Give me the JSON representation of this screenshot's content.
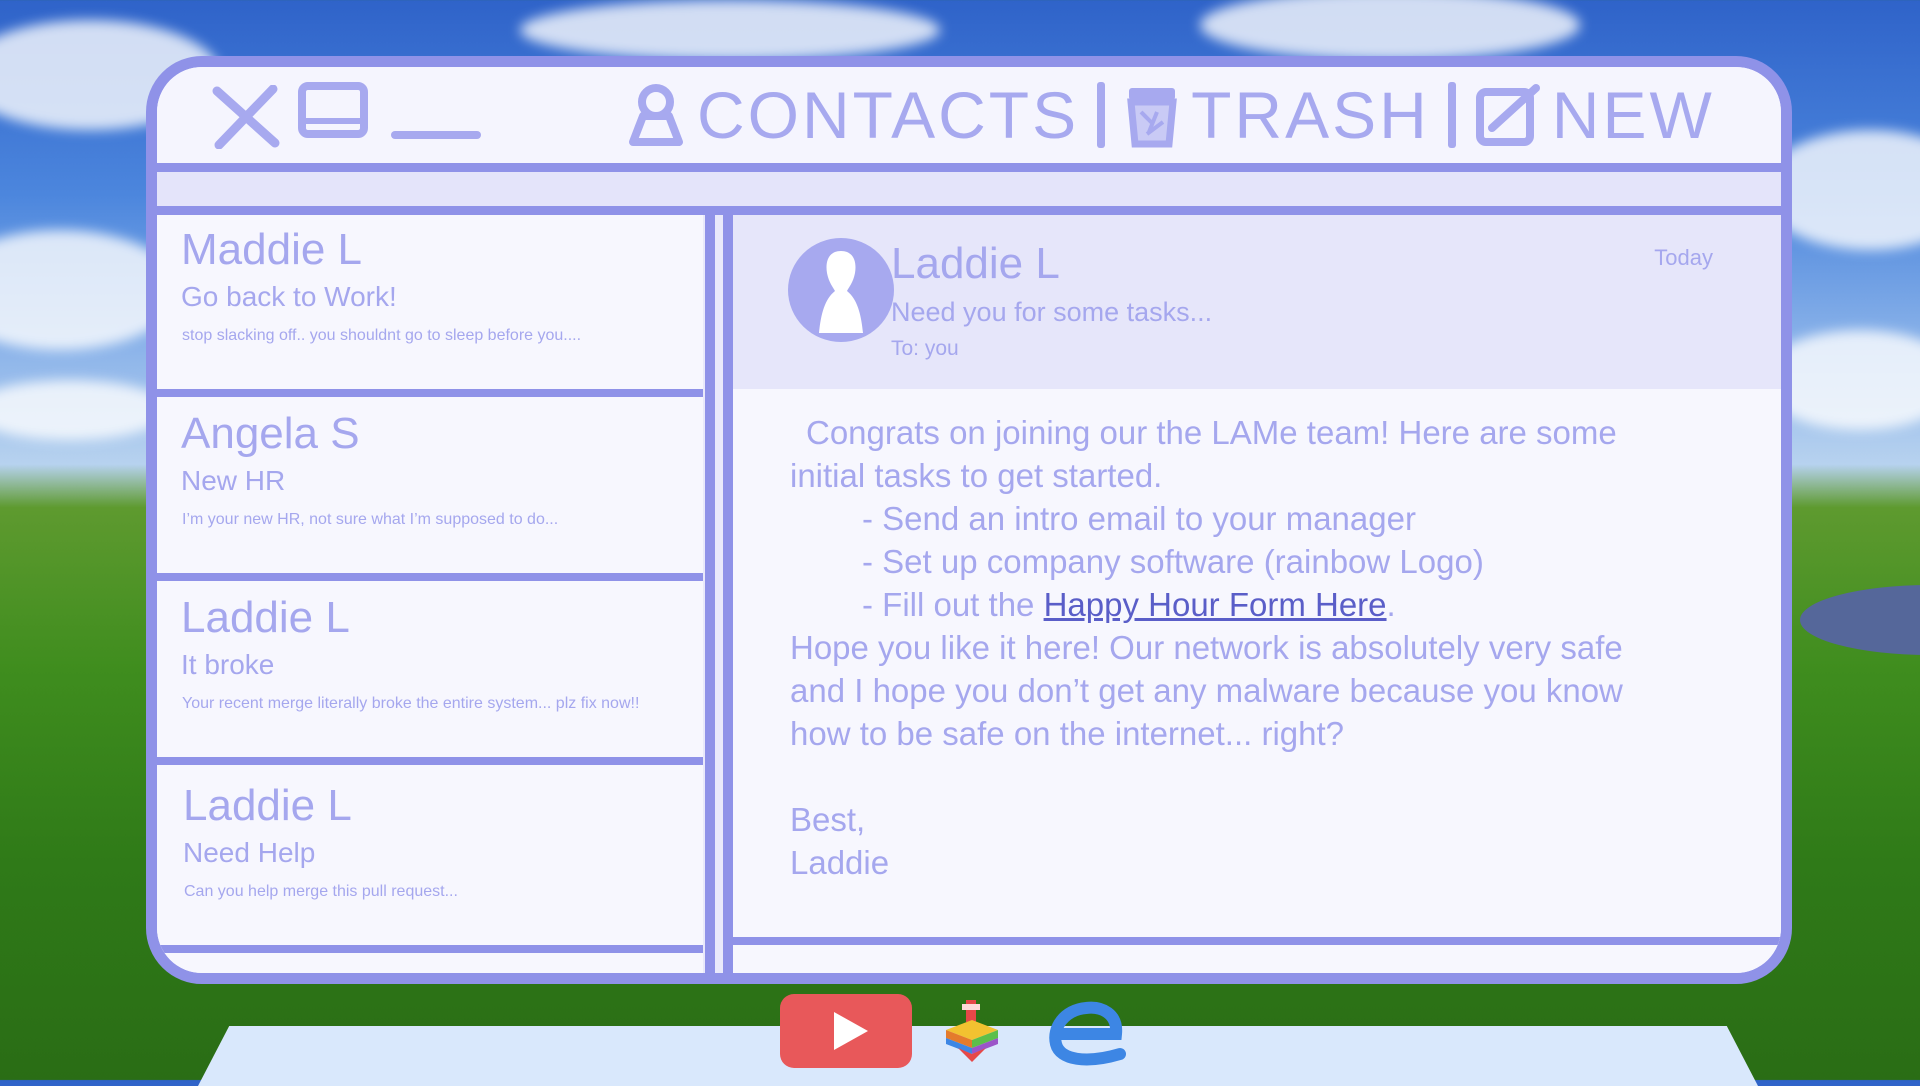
{
  "window": {
    "controls": [
      "close-icon",
      "maximize-icon",
      "minimize-icon"
    ],
    "nav": [
      {
        "label": "CONTACTS",
        "icon": "person-icon"
      },
      {
        "label": "TRASH",
        "icon": "trash-icon"
      },
      {
        "label": "NEW",
        "icon": "compose-icon"
      }
    ]
  },
  "inbox": {
    "messages": [
      {
        "sender": "Maddie L",
        "subject": "Go back to Work!",
        "preview": "stop slacking off.. you shouldnt go to sleep before you...."
      },
      {
        "sender": "Angela S",
        "subject": "New HR",
        "preview": "I’m your new HR, not sure what I’m supposed to do..."
      },
      {
        "sender": "Laddie L",
        "subject": "It broke",
        "preview": "Your recent merge literally broke the entire system... plz fix now!!"
      },
      {
        "sender": "Laddie L",
        "subject": "Need Help",
        "preview": "Can you help merge this pull request..."
      }
    ]
  },
  "reader": {
    "sender": "Laddie L",
    "subject": "Need you for some tasks...",
    "to": "To: you",
    "date": "Today",
    "body": {
      "intro_1": "Congrats on joining our the LAMe team! Here are some",
      "intro_2": "initial tasks to get started.",
      "task_1": "- Send an intro email to your manager",
      "task_2": "- Set up company software (rainbow Logo)",
      "task_3_prefix": "- Fill out the ",
      "task_3_link": "Happy Hour Form Here",
      "task_3_suffix": ".",
      "closing_1": "Hope you like it here! Our network is absolutely very safe",
      "closing_2": "and I hope you don’t get any malware because you know",
      "closing_3": "how to be safe on the internet... right?",
      "signoff_1": "Best,",
      "signoff_2": "Laddie"
    }
  },
  "taskbar": {
    "icons": [
      "youtube-icon",
      "rainbow-logo-icon",
      "browser-e-icon"
    ]
  },
  "colors": {
    "accent": "#8f92e8",
    "text": "#a5a7ee",
    "link": "#5a5ec8",
    "youtube": "#e8585a",
    "browser": "#3d86e4"
  }
}
